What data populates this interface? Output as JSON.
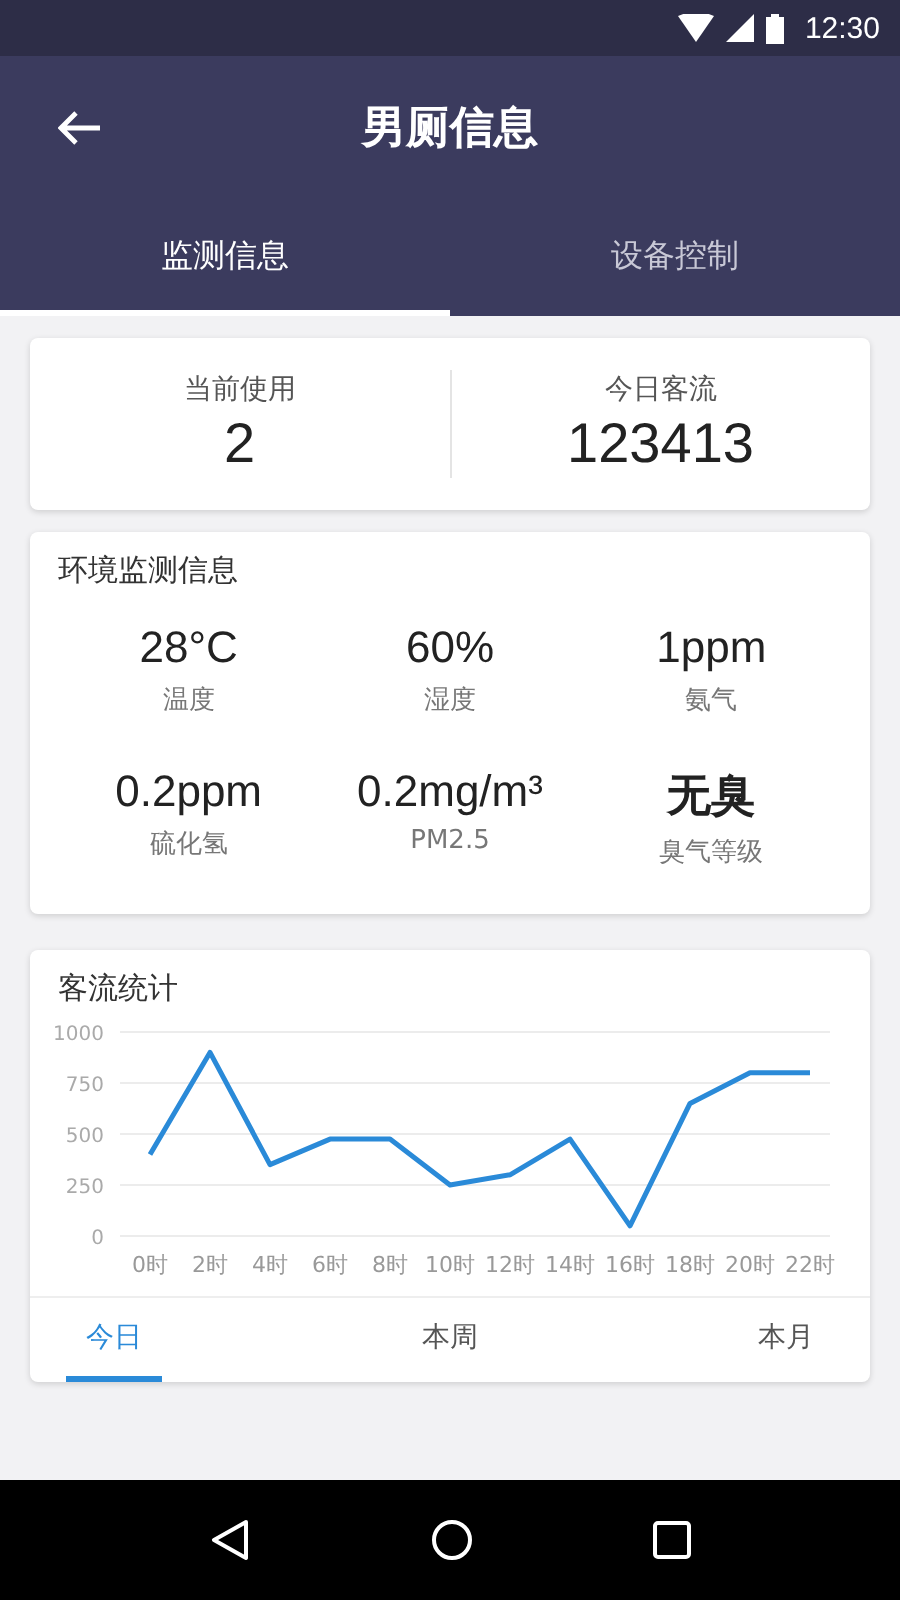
{
  "status_bar": {
    "time": "12:30"
  },
  "app_bar": {
    "title": "男厕信息"
  },
  "tabs": [
    {
      "label": "监测信息",
      "selected": true
    },
    {
      "label": "设备控制",
      "selected": false
    }
  ],
  "summary": [
    {
      "label": "当前使用",
      "value": "2"
    },
    {
      "label": "今日客流",
      "value": "123413"
    }
  ],
  "environment": {
    "title": "环境监测信息",
    "items": [
      {
        "value": "28°C",
        "label": "温度"
      },
      {
        "value": "60%",
        "label": "湿度"
      },
      {
        "value": "1ppm",
        "label": "氨气"
      },
      {
        "value": "0.2ppm",
        "label": "硫化氢"
      },
      {
        "value": "0.2mg/m³",
        "label": "PM2.5"
      },
      {
        "value": "无臭",
        "label": "臭气等级"
      }
    ]
  },
  "traffic": {
    "title": "客流统计",
    "chart_data": {
      "type": "line",
      "categories": [
        "0时",
        "2时",
        "4时",
        "6时",
        "8时",
        "10时",
        "12时",
        "14时",
        "16时",
        "18时",
        "20时",
        "22时"
      ],
      "values": [
        400,
        900,
        350,
        475,
        475,
        250,
        300,
        475,
        50,
        650,
        800,
        800
      ],
      "ylim": [
        0,
        1000
      ],
      "yticks": [
        0,
        250,
        500,
        750,
        1000
      ],
      "grid": true
    },
    "periods": [
      {
        "label": "今日",
        "selected": true
      },
      {
        "label": "本周",
        "selected": false
      },
      {
        "label": "本月",
        "selected": false
      }
    ]
  }
}
